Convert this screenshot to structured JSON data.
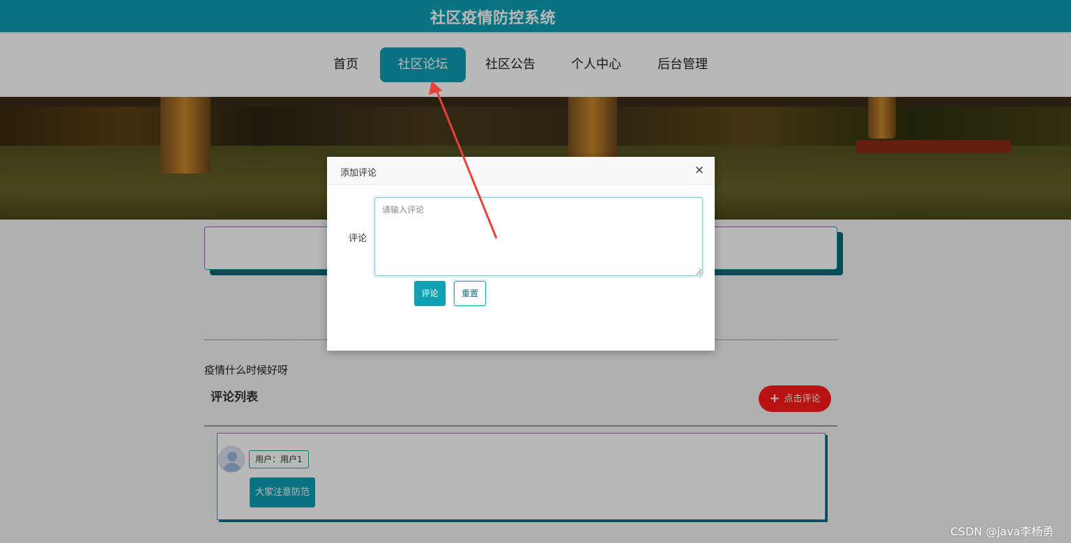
{
  "header": {
    "title": "社区疫情防控系统"
  },
  "nav": {
    "items": [
      {
        "label": "首页"
      },
      {
        "label": "社区论坛"
      },
      {
        "label": "社区公告"
      },
      {
        "label": "个人中心"
      },
      {
        "label": "后台管理"
      }
    ],
    "active_index": 1
  },
  "post": {
    "title": "疫情什么时候好呀",
    "comments_heading": "评论列表",
    "add_comment_label": "点击评论"
  },
  "comments": [
    {
      "user": "用户：用户1",
      "text": "大家注意防范"
    }
  ],
  "modal": {
    "title": "添加评论",
    "field_label": "评论",
    "textarea_placeholder": "请输入评论",
    "submit_label": "评论",
    "reset_label": "重置",
    "close_symbol": "×"
  },
  "watermark": "CSDN @java李杨勇",
  "colors": {
    "accent": "#0fa0b4",
    "danger": "#ff1a1a",
    "annotation_arrow": "#e8413a"
  }
}
